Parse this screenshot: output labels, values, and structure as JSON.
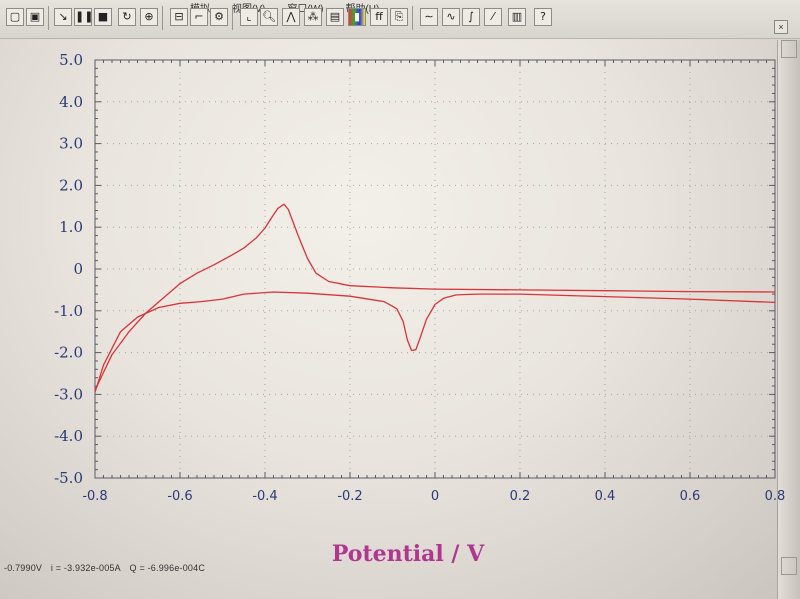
{
  "menu": {
    "items": [
      "模拟",
      "视图(V)",
      "窗口(W)",
      "帮助(H)"
    ]
  },
  "toolbar": {
    "buttons": [
      "doc-icon",
      "open-icon",
      "run-icon",
      "pause-icon",
      "stop-icon",
      "rerun-icon",
      "ir-icon",
      "params-icon",
      "technique-icon",
      "setup-icon",
      "graph-icon",
      "zoom-icon",
      "peak-icon",
      "overlay-icon",
      "color-icon",
      "font-icon",
      "copy-icon",
      "smooth-icon",
      "deriv-icon",
      "integrate-icon",
      "baseline-icon",
      "table-icon",
      "help-icon"
    ]
  },
  "status": {
    "potential": "-0.7990V",
    "current": "i = -3.932e-005A",
    "charge": "Q = -6.996e-004C"
  },
  "chart_data": {
    "type": "line",
    "title": "",
    "xlabel": "Potential / V",
    "ylabel": "",
    "xlim": [
      -0.8,
      0.8
    ],
    "ylim": [
      -5.0,
      5.0
    ],
    "x_reversed": false,
    "xticks": [
      -0.8,
      -0.6,
      -0.4,
      -0.2,
      0,
      0.2,
      0.4,
      0.6,
      0.8
    ],
    "xtick_labels": [
      "-0.8",
      "-0.6",
      "-0.4",
      "-0.2",
      "0",
      "0.2",
      "0.4",
      "0.6",
      "0.8"
    ],
    "yticks": [
      5.0,
      4.0,
      3.0,
      2.0,
      1.0,
      0,
      -1.0,
      -2.0,
      -3.0,
      -4.0,
      -5.0
    ],
    "ytick_labels": [
      "5.0",
      "4.0",
      "3.0",
      "2.0",
      "1.0",
      "0",
      "-1.0",
      "-2.0",
      "-3.0",
      "-4.0",
      "-5.0"
    ],
    "grid": "dotted",
    "line_color": "#d9343a",
    "series": [
      {
        "x": [
          -0.8,
          -0.76,
          -0.72,
          -0.68,
          -0.64,
          -0.6,
          -0.56,
          -0.52,
          -0.48,
          -0.45,
          -0.42,
          -0.4,
          -0.385,
          -0.37,
          -0.355,
          -0.345,
          -0.335,
          -0.32,
          -0.3,
          -0.28,
          -0.25,
          -0.2,
          -0.1,
          0.0,
          0.2,
          0.4,
          0.6,
          0.8
        ],
        "y": [
          -2.9,
          -2.05,
          -1.5,
          -1.05,
          -0.7,
          -0.35,
          -0.1,
          0.1,
          0.32,
          0.5,
          0.75,
          0.98,
          1.22,
          1.45,
          1.55,
          1.42,
          1.15,
          0.75,
          0.25,
          -0.1,
          -0.3,
          -0.4,
          -0.45,
          -0.48,
          -0.5,
          -0.52,
          -0.54,
          -0.55
        ]
      },
      {
        "x": [
          0.8,
          0.6,
          0.4,
          0.2,
          0.1,
          0.05,
          0.02,
          0.0,
          -0.02,
          -0.035,
          -0.045,
          -0.055,
          -0.065,
          -0.075,
          -0.09,
          -0.12,
          -0.2,
          -0.3,
          -0.38,
          -0.45,
          -0.5,
          -0.55,
          -0.6,
          -0.65,
          -0.7,
          -0.74,
          -0.78,
          -0.8
        ],
        "y": [
          -0.8,
          -0.72,
          -0.66,
          -0.6,
          -0.6,
          -0.62,
          -0.7,
          -0.85,
          -1.2,
          -1.65,
          -1.93,
          -1.95,
          -1.7,
          -1.25,
          -0.95,
          -0.78,
          -0.65,
          -0.58,
          -0.55,
          -0.6,
          -0.72,
          -0.78,
          -0.82,
          -0.92,
          -1.15,
          -1.5,
          -2.3,
          -2.95
        ]
      }
    ]
  }
}
